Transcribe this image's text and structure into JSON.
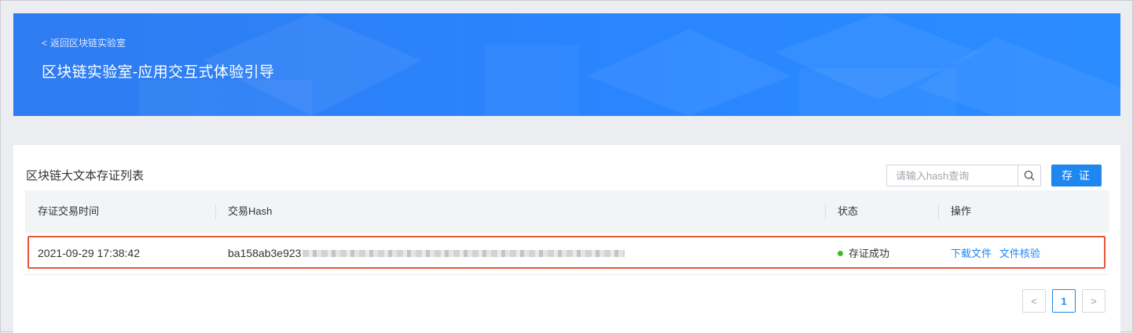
{
  "header": {
    "back_label": "返回区块链实验室",
    "title": "区块链实验室-应用交互式体验引导"
  },
  "list": {
    "title": "区块链大文本存证列表",
    "search_placeholder": "请输入hash查询",
    "search_icon": "search-icon",
    "save_label": "存 证",
    "columns": [
      "存证交易时间",
      "交易Hash",
      "状态",
      "操作"
    ],
    "rows": [
      {
        "time": "2021-09-29 17:38:42",
        "hash_prefix": "ba158ab3e923",
        "status": "存证成功",
        "action_download": "下载文件",
        "action_verify": "文件核验"
      }
    ]
  },
  "pagination": {
    "prev": "<",
    "current": "1",
    "next": ">"
  },
  "colors": {
    "banner": "#2a85ff",
    "accent": "#1e87f0",
    "success": "#3fba2a",
    "highlight": "#e8553a"
  }
}
